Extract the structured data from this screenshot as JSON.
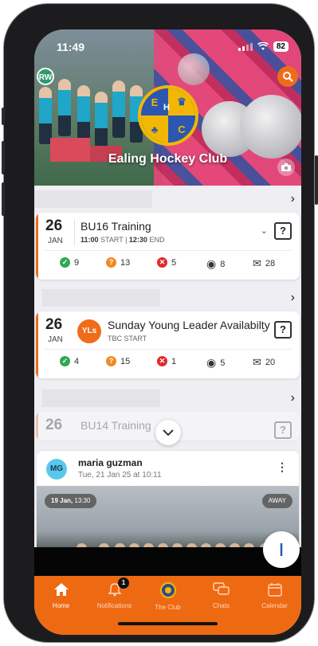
{
  "status_bar": {
    "time": "11:49",
    "battery": "82"
  },
  "header": {
    "avatar_initials": "RW",
    "club_name": "Ealing Hockey Club",
    "badge_letters": [
      "E",
      "H",
      "C"
    ]
  },
  "events": [
    {
      "day": "26",
      "month": "JAN",
      "title": "BU16 Training",
      "start_time": "11:00",
      "start_label": "START",
      "end_time": "12:30",
      "end_label": "END",
      "yes": "9",
      "maybe": "13",
      "no": "5",
      "views": "8",
      "messages": "28"
    },
    {
      "day": "26",
      "month": "JAN",
      "avatar": "YLs",
      "title": "Sunday Young Leader Availabilty",
      "subtitle": "TBC START",
      "yes": "4",
      "maybe": "15",
      "no": "1",
      "views": "5",
      "messages": "20"
    },
    {
      "day": "26",
      "title": "BU14 Training"
    }
  ],
  "post": {
    "avatar_initials": "MG",
    "author": "maria guzman",
    "date": "Tue, 21 Jan 25 at 10:11",
    "photo_date": "19 Jan,",
    "photo_time": "13:30",
    "photo_tag": "AWAY"
  },
  "tabbar": {
    "items": [
      {
        "label": "Home",
        "icon": "home-icon",
        "active": true
      },
      {
        "label": "Notifications",
        "icon": "bell-icon",
        "badge": "1"
      },
      {
        "label": "The Club",
        "icon": "club-icon"
      },
      {
        "label": "Chats",
        "icon": "chat-icon"
      },
      {
        "label": "Calendar",
        "icon": "calendar-icon"
      }
    ]
  },
  "colors": {
    "accent": "#ee6a12",
    "yes": "#2eaa4f",
    "maybe": "#f08a24",
    "no": "#e02a2a"
  }
}
